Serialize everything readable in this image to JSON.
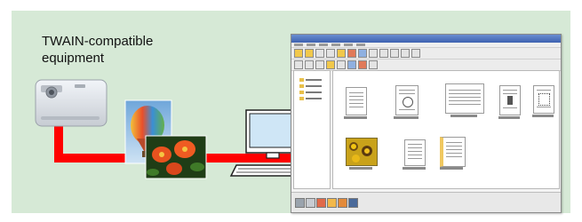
{
  "caption": {
    "text": "TWAIN-compatible\nequipment"
  },
  "app_window": {
    "title": "",
    "folders": [
      "folder",
      "folder",
      "folder",
      "folder"
    ],
    "thumbnails": [
      {
        "name": "thumbnail-1",
        "kind": "document"
      },
      {
        "name": "thumbnail-2",
        "kind": "document"
      },
      {
        "name": "thumbnail-3",
        "kind": "document"
      },
      {
        "name": "thumbnail-4",
        "kind": "document"
      },
      {
        "name": "thumbnail-5",
        "kind": "document"
      },
      {
        "name": "thumbnail-6",
        "kind": "photo"
      },
      {
        "name": "thumbnail-7",
        "kind": "document"
      },
      {
        "name": "thumbnail-8",
        "kind": "document"
      }
    ]
  },
  "icons": {
    "camera": "digital-camera-icon",
    "balloon": "hot-air-balloon-photo",
    "flowers": "flower-photo",
    "computer": "desktop-computer-icon",
    "arrow": "red-arrow"
  },
  "colors": {
    "background": "#d6e9d6",
    "arrow": "#ff0000",
    "window_title": "#3e62b0"
  }
}
